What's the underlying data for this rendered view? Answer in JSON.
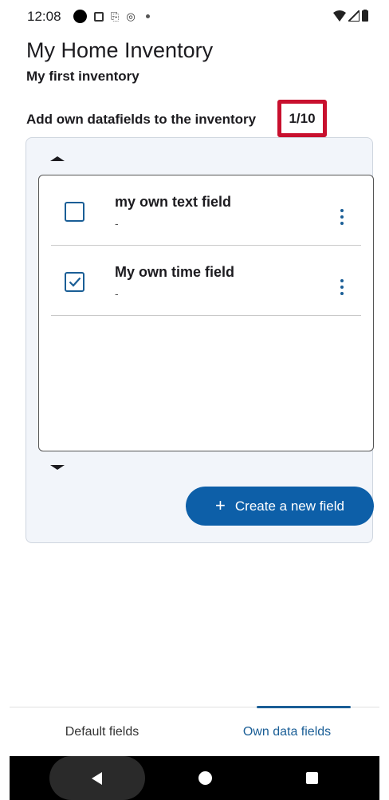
{
  "status_bar": {
    "time": "12:08"
  },
  "header": {
    "title": "My Home Inventory",
    "subtitle": "My first inventory"
  },
  "datafields": {
    "add_label": "Add own datafields to the inventory",
    "counter": "1/10"
  },
  "fields": [
    {
      "name": "my own text field",
      "value": "-",
      "checked": false
    },
    {
      "name": "My own time field",
      "value": "-",
      "checked": true
    }
  ],
  "create_button": {
    "label": "Create a new field",
    "icon": "plus-icon"
  },
  "tabs": [
    {
      "label": "Default fields",
      "selected": false
    },
    {
      "label": "Own data fields",
      "selected": true
    }
  ],
  "colors": {
    "accent": "#0d5fa8",
    "highlight": "#c8102e",
    "panel": "#f2f5fa"
  }
}
